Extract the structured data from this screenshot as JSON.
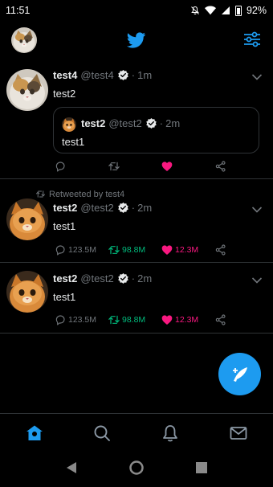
{
  "status_bar": {
    "time": "11:51",
    "battery": "92%"
  },
  "header": {
    "icons": [
      "profile-avatar",
      "twitter-bird-icon",
      "filter-sliders-icon"
    ]
  },
  "tweets": [
    {
      "name": "test4",
      "handle": "@test4",
      "time": "1m",
      "text": "test2",
      "quote": {
        "name": "test2",
        "handle": "@test2",
        "time": "2m",
        "text": "test1"
      },
      "liked": true
    },
    {
      "retweeted_by": "Retweeted by test4",
      "name": "test2",
      "handle": "@test2",
      "time": "2m",
      "text": "test1",
      "replies": "123.5M",
      "retweets": "98.8M",
      "likes": "12.3M"
    },
    {
      "name": "test2",
      "handle": "@test2",
      "time": "2m",
      "text": "test1",
      "replies": "123.5M",
      "retweets": "98.8M",
      "likes": "12.3M"
    }
  ],
  "dot": "·",
  "colors": {
    "accent": "#1d9bf0",
    "retweet": "#00ba7c",
    "like": "#f91880",
    "muted": "#71767b",
    "background": "#000000"
  },
  "bottom_nav": {
    "items": [
      "home-icon",
      "search-icon",
      "notifications-icon",
      "messages-icon"
    ],
    "active": "home"
  },
  "fab": {
    "icon": "compose-tweet-icon"
  }
}
